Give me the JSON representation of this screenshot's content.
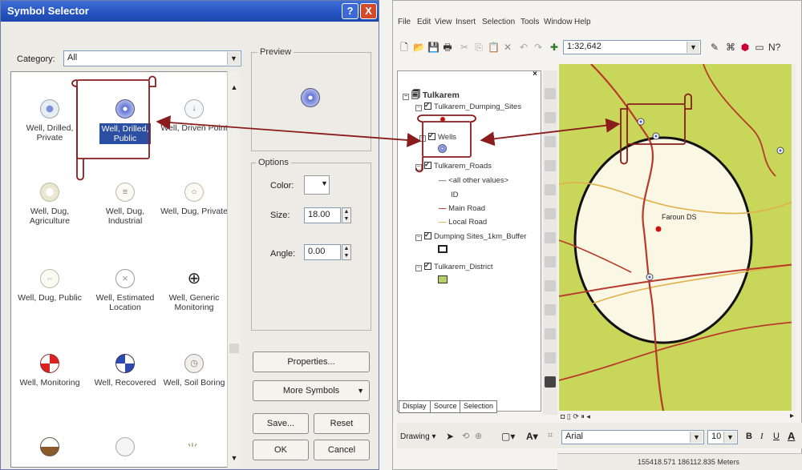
{
  "dialog": {
    "title": "Symbol Selector",
    "help_label": "?",
    "close_label": "X",
    "category_label": "Category:",
    "category_value": "All",
    "preview_label": "Preview",
    "options_label": "Options",
    "color_label": "Color:",
    "size_label": "Size:",
    "size_value": "18.00",
    "angle_label": "Angle:",
    "angle_value": "0.00",
    "symbols": [
      {
        "label": "Well, Drilled, Private",
        "icon": "well-drilled-private-icon"
      },
      {
        "label": "Well, Drilled, Public",
        "icon": "well-drilled-public-icon",
        "selected": true
      },
      {
        "label": "Well, Driven Point",
        "icon": "well-driven-point-icon"
      },
      {
        "label": "Well, Dug, Agriculture",
        "icon": "well-dug-agriculture-icon"
      },
      {
        "label": "Well, Dug, Industrial",
        "icon": "well-dug-industrial-icon"
      },
      {
        "label": "Well, Dug, Private",
        "icon": "well-dug-private-icon"
      },
      {
        "label": "Well, Dug, Public",
        "icon": "well-dug-public-icon"
      },
      {
        "label": "Well, Estimated Location",
        "icon": "well-estimated-location-icon"
      },
      {
        "label": "Well, Generic Monitoring",
        "icon": "well-generic-monitoring-icon"
      },
      {
        "label": "Well, Monitoring",
        "icon": "well-monitoring-icon"
      },
      {
        "label": "Well, Recovered",
        "icon": "well-recovered-icon"
      },
      {
        "label": "Well, Soil Boring",
        "icon": "well-soil-boring-icon"
      }
    ],
    "buttons": {
      "properties": "Properties...",
      "more_symbols": "More Symbols",
      "save": "Save...",
      "reset": "Reset",
      "ok": "OK",
      "cancel": "Cancel"
    }
  },
  "arcmap": {
    "menu": [
      "File",
      "Edit",
      "View",
      "Insert",
      "Selection",
      "Tools",
      "Window",
      "Help"
    ],
    "scale": "1:32,642",
    "toc": {
      "root": "Tulkarem",
      "layers": [
        {
          "name": "Tulkarem_Dumping_Sites"
        },
        {
          "name": "Wells"
        },
        {
          "name": "Tulkarem_Roads"
        },
        {
          "name": "<all other values>"
        },
        {
          "name": "ID"
        },
        {
          "name": "Main Road"
        },
        {
          "name": "Local Road"
        },
        {
          "name": "Dumping Sites_1km_Buffer"
        },
        {
          "name": "Tulkarem_District"
        }
      ]
    },
    "tabs": [
      "Display",
      "Source",
      "Selection"
    ],
    "map_label": "Faroun DS",
    "drawing_label": "Drawing",
    "font_name": "Arial",
    "font_size": "10",
    "coordinates": "155418.571  186112.835 Meters"
  },
  "colors": {
    "title_bar": "#2452c0",
    "map_background": "#c8d75a",
    "buffer_fill": "#faf7e4",
    "main_road": "#b73a2a",
    "local_road": "#e0b146",
    "annotation": "#8b1c1c",
    "selection": "#2a4fa3"
  }
}
